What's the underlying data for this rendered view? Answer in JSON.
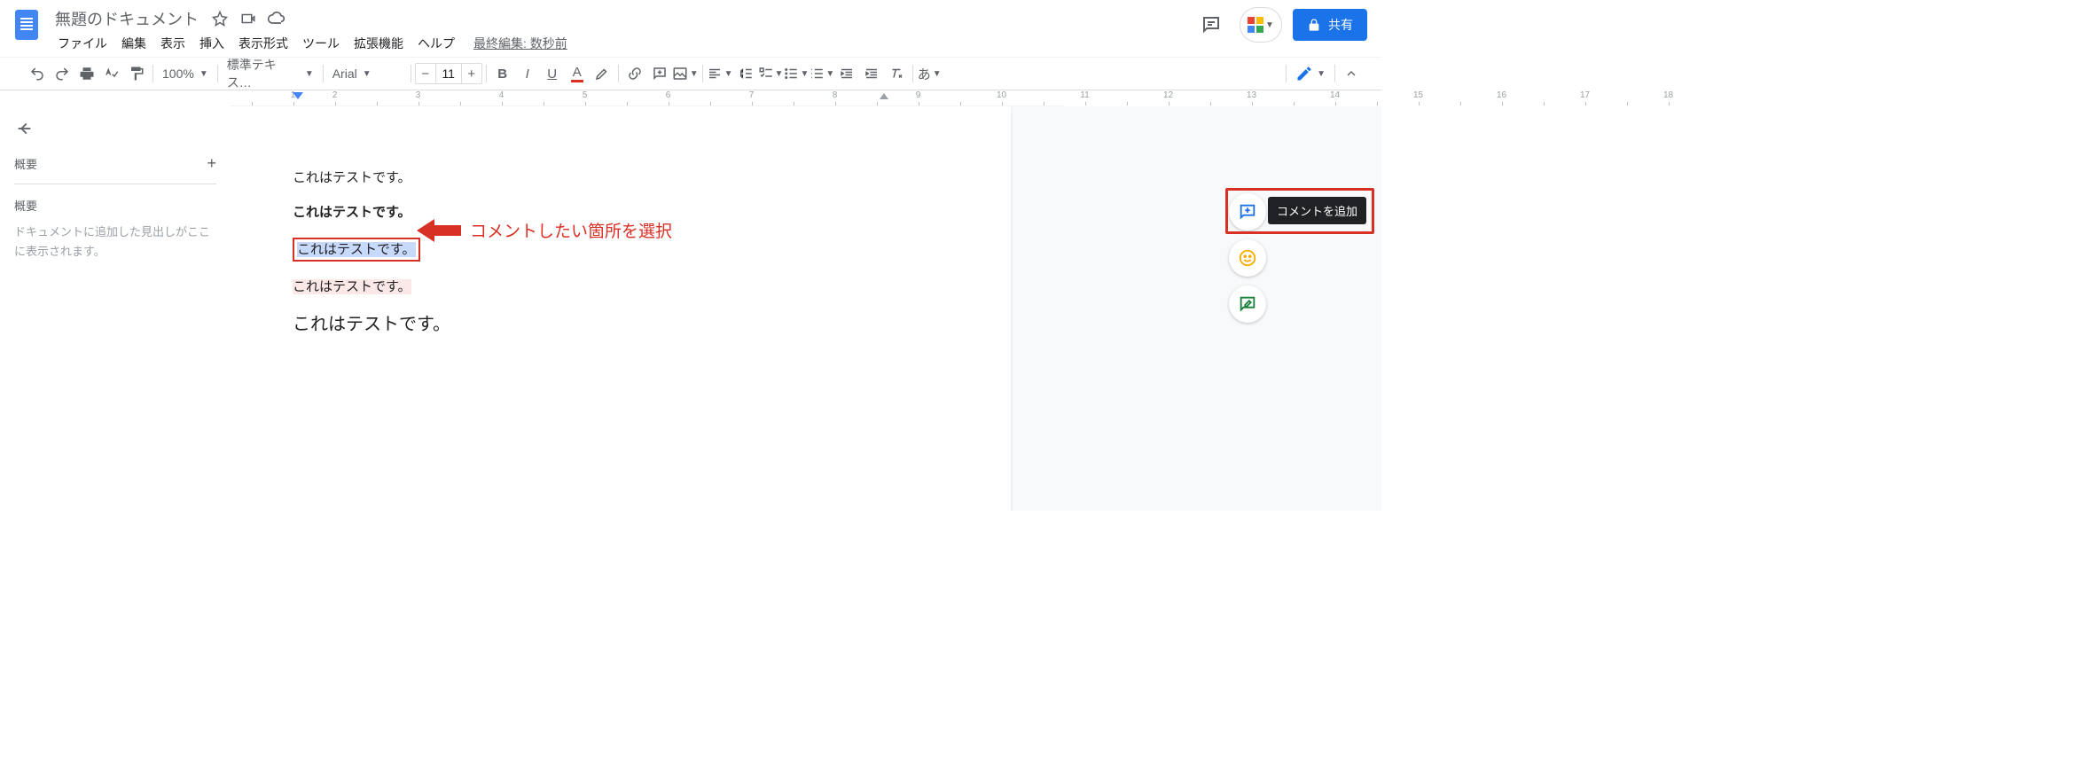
{
  "header": {
    "doc_title": "無題のドキュメント",
    "last_edit": "最終編集: 数秒前",
    "share_label": "共有"
  },
  "menu": {
    "file": "ファイル",
    "edit": "編集",
    "view": "表示",
    "insert": "挿入",
    "format": "表示形式",
    "tools": "ツール",
    "extensions": "拡張機能",
    "help": "ヘルプ"
  },
  "toolbar": {
    "zoom": "100%",
    "style": "標準テキス…",
    "font": "Arial",
    "font_size": "11",
    "ime": "あ"
  },
  "ruler_ticks": [
    "",
    "1",
    "2",
    "",
    "3",
    "",
    "4",
    "",
    "5",
    "",
    "6",
    "",
    "7",
    "",
    "8",
    "",
    "9",
    "",
    "10",
    "",
    "11",
    "",
    "12",
    "",
    "13",
    "",
    "14",
    "",
    "15",
    "",
    "16",
    "",
    "17",
    "",
    "18"
  ],
  "sidebar": {
    "outline_label": "概要",
    "outline_sub": "概要",
    "placeholder": "ドキュメントに追加した見出しがここに表示されます。"
  },
  "document": {
    "line1": "これはテストです。",
    "line2": "これはテストです。",
    "line3": "これはテストです。",
    "line4": "これはテストです。",
    "line5": "これはテストです。"
  },
  "annotation": {
    "text": "コメントしたい箇所を選択",
    "tooltip": "コメントを追加"
  }
}
